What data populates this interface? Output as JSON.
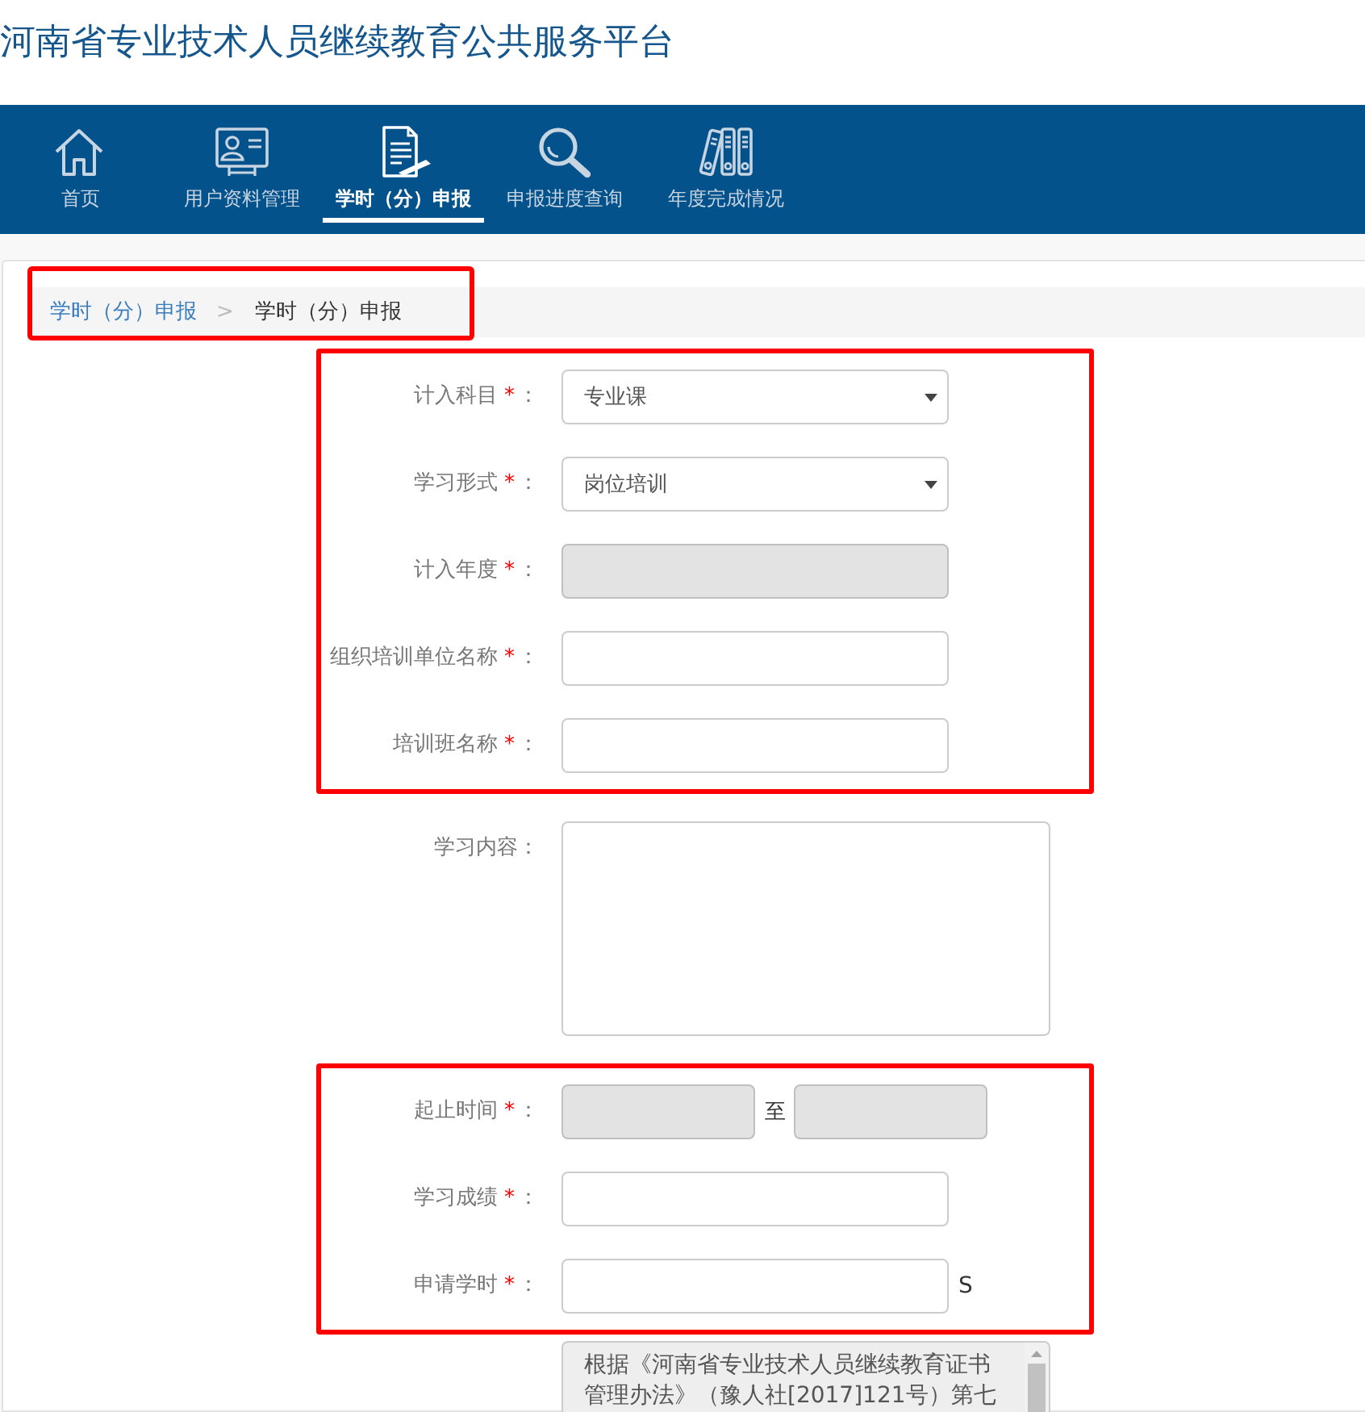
{
  "header": {
    "title": "河南省专业技术人员继续教育公共服务平台"
  },
  "nav": {
    "tabs": [
      {
        "label": "首页",
        "selected": false
      },
      {
        "label": "用户资料管理",
        "selected": false
      },
      {
        "label": "学时（分）申报",
        "selected": true
      },
      {
        "label": "申报进度查询",
        "selected": false
      },
      {
        "label": "年度完成情况",
        "selected": false
      }
    ]
  },
  "breadcrumb": {
    "highlighted": true,
    "separator": ">",
    "items": [
      {
        "kind": "link",
        "label": "学时（分）申报"
      },
      {
        "kind": "current",
        "label": "学时（分）申报"
      }
    ]
  },
  "form": {
    "groups": [
      {
        "highlighted": true,
        "fields": [
          {
            "kind": "select",
            "label": "计入科目",
            "required_mark": "*",
            "colon": "：",
            "value": "专业课",
            "disabled": false
          },
          {
            "kind": "select",
            "label": "学习形式",
            "required_mark": "*",
            "colon": "：",
            "value": "岗位培训",
            "disabled": false
          },
          {
            "kind": "input",
            "label": "计入年度",
            "required_mark": "*",
            "colon": "：",
            "disabled": true
          },
          {
            "kind": "input",
            "label": "组织培训单位名称",
            "required_mark": "*",
            "colon": "：",
            "disabled": false
          },
          {
            "kind": "input",
            "label": "培训班名称",
            "required_mark": "*",
            "colon": "：",
            "disabled": false
          }
        ]
      },
      {
        "highlighted": false,
        "fields": [
          {
            "kind": "textarea",
            "label": "学习内容",
            "colon": "：",
            "disabled": false
          }
        ]
      },
      {
        "highlighted": true,
        "fields": [
          {
            "kind": "date_range",
            "label": "起止时间",
            "required_mark": "*",
            "colon": "：",
            "separator": "至",
            "disabled": true
          },
          {
            "kind": "input",
            "label": "学习成绩",
            "required_mark": "*",
            "colon": "：",
            "disabled": false
          },
          {
            "kind": "input",
            "label": "申请学时",
            "required_mark": "*",
            "colon": "：",
            "suffix": "S",
            "disabled": false
          }
        ]
      }
    ],
    "notice": {
      "text": "根据《河南省专业技术人员继续教育证书管理办法》（豫人社[2017]121号）第七"
    }
  }
}
